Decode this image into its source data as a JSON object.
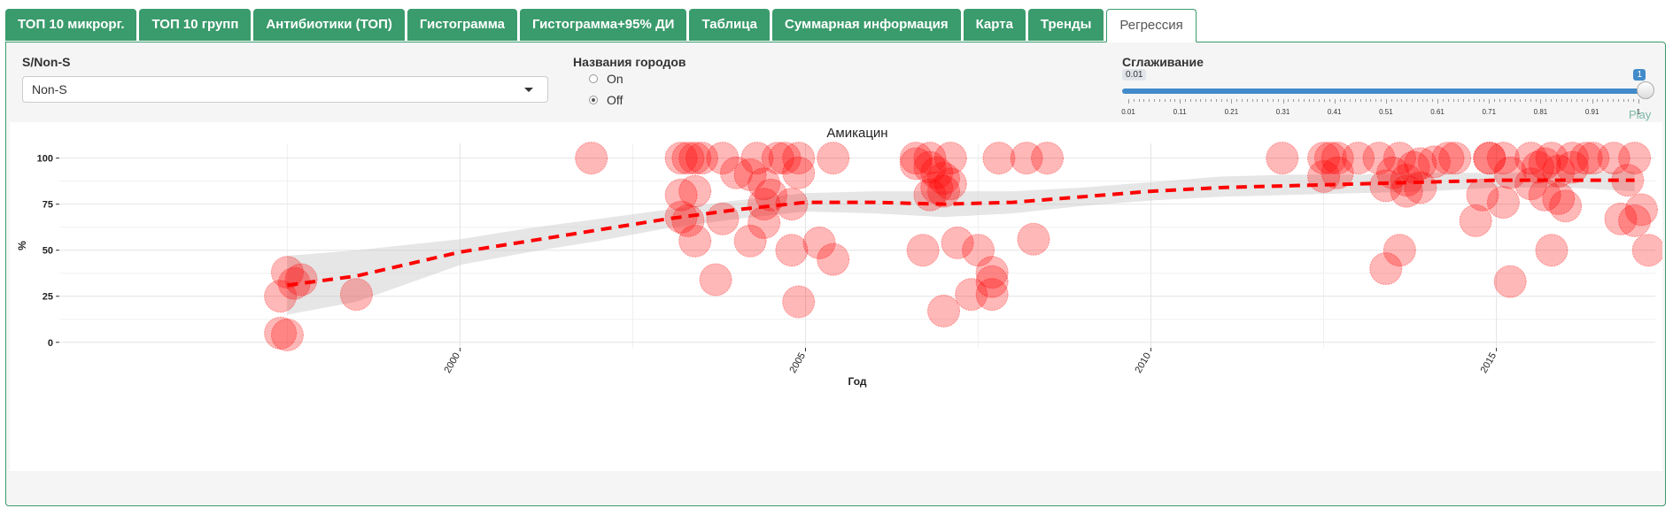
{
  "tabs": [
    {
      "label": "ТОП 10 микрорг.",
      "active": false
    },
    {
      "label": "ТОП 10 групп",
      "active": false
    },
    {
      "label": "Антибиотики (ТОП)",
      "active": false
    },
    {
      "label": "Гистограмма",
      "active": false
    },
    {
      "label": "Гистограмма+95% ДИ",
      "active": false
    },
    {
      "label": "Таблица",
      "active": false
    },
    {
      "label": "Суммарная информация",
      "active": false
    },
    {
      "label": "Карта",
      "active": false
    },
    {
      "label": "Тренды",
      "active": false
    },
    {
      "label": "Регрессия",
      "active": true
    }
  ],
  "controls": {
    "snons": {
      "label": "S/Non-S",
      "value": "Non-S"
    },
    "cities": {
      "label": "Названия городов",
      "options": [
        {
          "label": "On",
          "checked": false
        },
        {
          "label": "Off",
          "checked": true
        }
      ]
    },
    "smoothing": {
      "label": "Сглаживание",
      "min_label": "0.01",
      "value_label": "1",
      "play_label": "Play",
      "min": 0.01,
      "max": 1,
      "value": 1,
      "tick_labels": [
        "0.01",
        "0.11",
        "0.21",
        "0.31",
        "0.41",
        "0.51",
        "0.61",
        "0.71",
        "0.81",
        "0.91",
        "1"
      ]
    }
  },
  "colors": {
    "accent": "#3a9b6c",
    "point": "#ff0000",
    "trend": "#ff0000",
    "band": "#c8c8c8",
    "slider": "#428bca"
  },
  "chart_data": {
    "type": "scatter",
    "title": "Амикацин",
    "xlabel": "Год",
    "ylabel": "%",
    "xlim": [
      1994.2,
      2017.3
    ],
    "ylim": [
      -3,
      108
    ],
    "x_ticks": [
      2000,
      2005,
      2010,
      2015
    ],
    "y_ticks": [
      0,
      25,
      50,
      75,
      100
    ],
    "grid": true,
    "points": [
      [
        1997.4,
        5
      ],
      [
        1997.5,
        4
      ],
      [
        1997.4,
        25
      ],
      [
        1997.5,
        38
      ],
      [
        1997.6,
        32
      ],
      [
        1997.7,
        34
      ],
      [
        1998.5,
        26
      ],
      [
        2001.9,
        100
      ],
      [
        2003.2,
        100
      ],
      [
        2003.3,
        100
      ],
      [
        2003.4,
        100
      ],
      [
        2003.5,
        100
      ],
      [
        2003.8,
        100
      ],
      [
        2004.3,
        100
      ],
      [
        2004.9,
        100
      ],
      [
        2005.4,
        100
      ],
      [
        2003.2,
        80
      ],
      [
        2003.4,
        82
      ],
      [
        2003.2,
        68
      ],
      [
        2003.3,
        66
      ],
      [
        2003.4,
        55
      ],
      [
        2003.8,
        67
      ],
      [
        2003.7,
        34
      ],
      [
        2004.0,
        92
      ],
      [
        2004.2,
        91
      ],
      [
        2004.4,
        86
      ],
      [
        2004.5,
        80
      ],
      [
        2004.4,
        75
      ],
      [
        2004.4,
        65
      ],
      [
        2004.2,
        55
      ],
      [
        2004.6,
        100
      ],
      [
        2004.7,
        100
      ],
      [
        2004.9,
        92
      ],
      [
        2004.8,
        75
      ],
      [
        2004.8,
        50
      ],
      [
        2004.9,
        22
      ],
      [
        2005.2,
        54
      ],
      [
        2005.4,
        45
      ],
      [
        2006.6,
        100
      ],
      [
        2006.8,
        100
      ],
      [
        2007.1,
        100
      ],
      [
        2007.8,
        100
      ],
      [
        2008.2,
        100
      ],
      [
        2008.5,
        100
      ],
      [
        2006.6,
        97
      ],
      [
        2006.8,
        95
      ],
      [
        2006.9,
        92
      ],
      [
        2007.0,
        89
      ],
      [
        2007.1,
        86
      ],
      [
        2006.9,
        84
      ],
      [
        2007.0,
        82
      ],
      [
        2006.8,
        80
      ],
      [
        2006.7,
        50
      ],
      [
        2007.2,
        54
      ],
      [
        2007.5,
        50
      ],
      [
        2007.0,
        17
      ],
      [
        2007.4,
        26
      ],
      [
        2007.7,
        33
      ],
      [
        2007.7,
        38
      ],
      [
        2007.7,
        26
      ],
      [
        2008.3,
        56
      ],
      [
        2011.9,
        100
      ],
      [
        2012.5,
        100
      ],
      [
        2012.6,
        100
      ],
      [
        2012.7,
        100
      ],
      [
        2013.0,
        100
      ],
      [
        2013.3,
        100
      ],
      [
        2013.6,
        100
      ],
      [
        2014.4,
        100
      ],
      [
        2014.9,
        100
      ],
      [
        2012.5,
        90
      ],
      [
        2012.7,
        92
      ],
      [
        2013.4,
        85
      ],
      [
        2013.5,
        92
      ],
      [
        2013.7,
        88
      ],
      [
        2013.9,
        84
      ],
      [
        2013.7,
        82
      ],
      [
        2013.8,
        95
      ],
      [
        2013.9,
        97
      ],
      [
        2014.1,
        98
      ],
      [
        2014.3,
        100
      ],
      [
        2013.4,
        40
      ],
      [
        2013.6,
        50
      ],
      [
        2014.9,
        100
      ],
      [
        2015.1,
        100
      ],
      [
        2015.5,
        100
      ],
      [
        2015.8,
        100
      ],
      [
        2016.1,
        100
      ],
      [
        2016.3,
        100
      ],
      [
        2016.4,
        100
      ],
      [
        2015.2,
        92
      ],
      [
        2015.6,
        95
      ],
      [
        2015.7,
        97
      ],
      [
        2015.9,
        93
      ],
      [
        2016.1,
        95
      ],
      [
        2014.8,
        80
      ],
      [
        2015.1,
        76
      ],
      [
        2015.5,
        86
      ],
      [
        2015.7,
        80
      ],
      [
        2015.9,
        78
      ],
      [
        2016.0,
        74
      ],
      [
        2014.7,
        66
      ],
      [
        2015.2,
        33
      ],
      [
        2015.8,
        50
      ],
      [
        2016.7,
        100
      ],
      [
        2017.0,
        100
      ],
      [
        2016.9,
        88
      ],
      [
        2017.1,
        72
      ],
      [
        2017.0,
        66
      ],
      [
        2016.8,
        67
      ],
      [
        2017.2,
        50
      ]
    ],
    "trend": [
      [
        1997.5,
        31
      ],
      [
        1998.5,
        36
      ],
      [
        2000,
        49
      ],
      [
        2001,
        55
      ],
      [
        2002,
        61
      ],
      [
        2003,
        67
      ],
      [
        2004,
        72
      ],
      [
        2005,
        76
      ],
      [
        2006,
        76
      ],
      [
        2007,
        75
      ],
      [
        2008,
        76
      ],
      [
        2009,
        79
      ],
      [
        2010,
        82
      ],
      [
        2011,
        84
      ],
      [
        2012,
        85
      ],
      [
        2013,
        86
      ],
      [
        2014,
        87
      ],
      [
        2015,
        88
      ],
      [
        2016,
        88
      ],
      [
        2017,
        88
      ]
    ],
    "band": {
      "upper": [
        [
          1997.5,
          47
        ],
        [
          1998.5,
          50
        ],
        [
          2000,
          56
        ],
        [
          2001,
          62
        ],
        [
          2002,
          67
        ],
        [
          2003,
          72
        ],
        [
          2004,
          77
        ],
        [
          2005,
          81
        ],
        [
          2006,
          82
        ],
        [
          2007,
          82
        ],
        [
          2008,
          82
        ],
        [
          2009,
          84
        ],
        [
          2010,
          87
        ],
        [
          2011,
          90
        ],
        [
          2012,
          91
        ],
        [
          2013,
          91
        ],
        [
          2014,
          92
        ],
        [
          2015,
          92
        ],
        [
          2016,
          92
        ],
        [
          2017,
          93
        ]
      ],
      "lower": [
        [
          1997.5,
          15
        ],
        [
          1998.5,
          22
        ],
        [
          2000,
          42
        ],
        [
          2001,
          49
        ],
        [
          2002,
          55
        ],
        [
          2003,
          62
        ],
        [
          2004,
          67
        ],
        [
          2005,
          71
        ],
        [
          2006,
          70
        ],
        [
          2007,
          68
        ],
        [
          2008,
          70
        ],
        [
          2009,
          74
        ],
        [
          2010,
          77
        ],
        [
          2011,
          79
        ],
        [
          2012,
          80
        ],
        [
          2013,
          81
        ],
        [
          2014,
          82
        ],
        [
          2015,
          84
        ],
        [
          2016,
          84
        ],
        [
          2017,
          82
        ]
      ]
    }
  }
}
